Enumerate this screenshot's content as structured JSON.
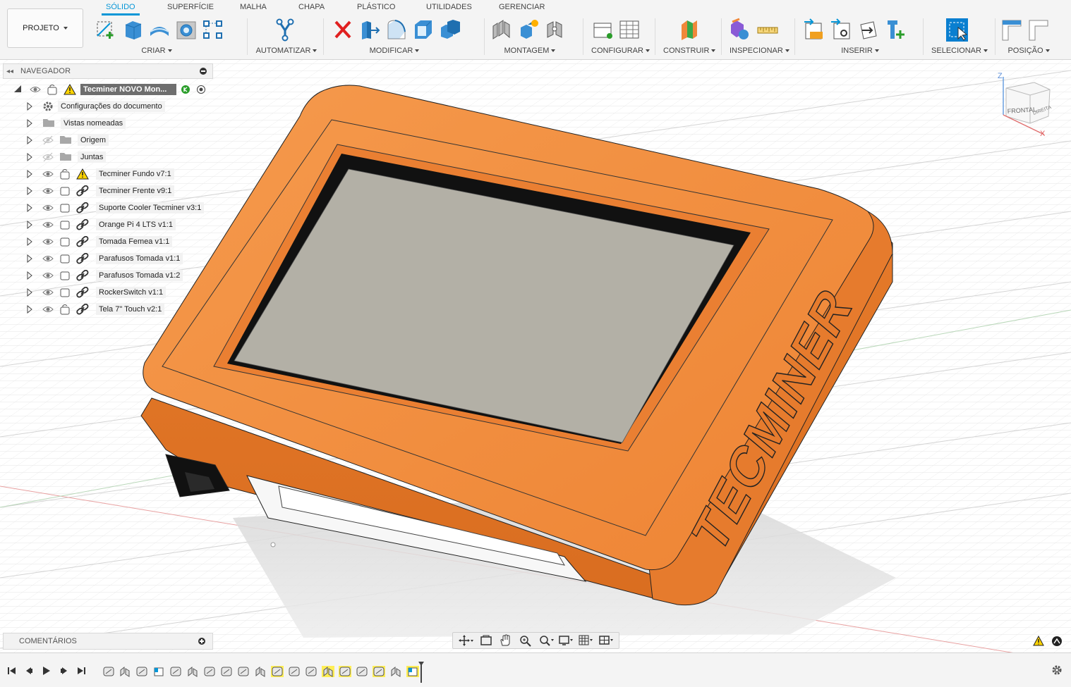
{
  "toolbar": {
    "project_label": "PROJETO",
    "tabs": [
      "SÓLIDO",
      "SUPERFÍCIE",
      "MALHA",
      "CHAPA",
      "PLÁSTICO",
      "UTILIDADES",
      "GERENCIAR"
    ],
    "active_tab": "SÓLIDO",
    "groups": {
      "criar": "CRIAR",
      "automatizar": "AUTOMATIZAR",
      "modificar": "MODIFICAR",
      "montagem": "MONTAGEM",
      "configurar": "CONFIGURAR",
      "construir": "CONSTRUIR",
      "inspecionar": "INSPECIONAR",
      "inserir": "INSERIR",
      "selecionar": "SELECIONAR",
      "posicao": "POSIÇÃO"
    },
    "accent_color": "#0696d7"
  },
  "navigator": {
    "title": "NAVEGADOR",
    "root": "Tecminer NOVO Mon...",
    "items": [
      {
        "label": "Configurações do documento",
        "icon": "gear-icon"
      },
      {
        "label": "Vistas nomeadas",
        "icon": "folder-icon"
      },
      {
        "label": "Origem",
        "icon": "folder-icon",
        "hidden": true
      },
      {
        "label": "Juntas",
        "icon": "folder-icon",
        "hidden": true
      },
      {
        "label": "Tecminer Fundo v7:1",
        "icon": "warning-icon"
      },
      {
        "label": "Tecminer Frente v9:1",
        "icon": "link-icon"
      },
      {
        "label": "Suporte Cooler Tecminer v3:1",
        "icon": "link-icon"
      },
      {
        "label": "Orange Pi 4 LTS v1:1",
        "icon": "link-icon"
      },
      {
        "label": "Tomada Femea v1:1",
        "icon": "link-icon"
      },
      {
        "label": "Parafusos Tomada v1:1",
        "icon": "link-icon"
      },
      {
        "label": "Parafusos Tomada v1:2",
        "icon": "link-icon"
      },
      {
        "label": "RockerSwitch v1:1",
        "icon": "link-icon"
      },
      {
        "label": "Tela 7\" Touch v2:1",
        "icon": "link-icon"
      }
    ]
  },
  "comments": {
    "title": "COMENTÁRIOS"
  },
  "viewcube": {
    "face_front": "FRONTAL",
    "face_right": "DIREITA",
    "axis_z": "Z",
    "axis_x": "X"
  },
  "model": {
    "brand_text": "TECMINER",
    "body_color": "#f0883a",
    "screen_color": "#b3b0a6"
  }
}
